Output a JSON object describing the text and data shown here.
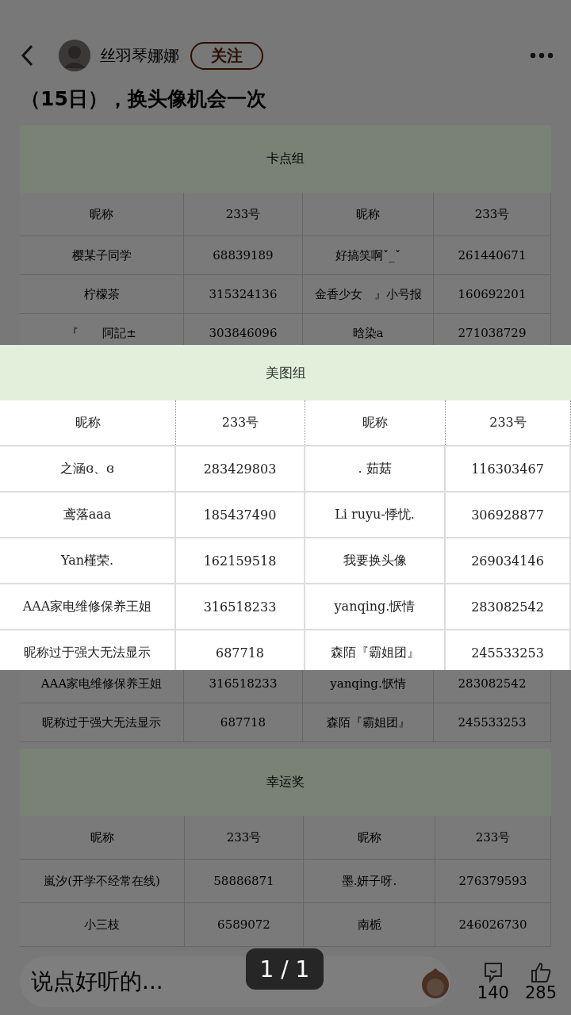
{
  "header": {
    "author": "丝羽琴娜娜",
    "follow_button": "关注"
  },
  "post_title": "（15日），换头像机会一次",
  "tables": [
    {
      "title": "卡点组",
      "columns": [
        "昵称",
        "233号",
        "昵称",
        "233号"
      ],
      "rows": [
        [
          "樱某子同学",
          "68839189",
          "好搞笑啊ˇ_ˇ",
          "261440671"
        ],
        [
          "柠檬茶",
          "315324136",
          "金香少女　』小号报",
          "160692201"
        ],
        [
          "『　　阿記±",
          "303846096",
          "晗染a",
          "271038729"
        ]
      ],
      "lower_rows": [
        [
          "AAA家电维修保养王姐",
          "316518233",
          "yanqing.恹情",
          "283082542"
        ],
        [
          "昵称过于强大无法显示",
          "687718",
          "森陌『霸姐团』",
          "245533253"
        ]
      ]
    },
    {
      "title": "幸运奖",
      "columns": [
        "昵称",
        "233号",
        "昵称",
        "233号"
      ],
      "rows": [
        [
          "嵐汐(开学不经常在线)",
          "58886871",
          "墨.妍子呀.",
          "276379593"
        ],
        [
          "小三枝",
          "6589072",
          "南栀",
          "246026730"
        ]
      ]
    }
  ],
  "viewer": {
    "title": "美图组",
    "columns": [
      "昵称",
      "233号",
      "昵称",
      "233号"
    ],
    "rows": [
      [
        "之涵ɞ、ɞ",
        "283429803",
        ". 茹菇",
        "116303467"
      ],
      [
        "鸢落aaa",
        "185437490",
        "Li ruyu-悸忧.",
        "306928877"
      ],
      [
        "Yan槿荣.",
        "162159518",
        "我要换头像",
        "269034146"
      ],
      [
        "AAA家电维修保养王姐",
        "316518233",
        "yanqing.恹情",
        "283082542"
      ],
      [
        "昵称过于强大无法显示",
        "687718",
        "森陌『霸姐团』",
        "245533253"
      ]
    ],
    "page_indicator": "1 / 1"
  },
  "bottom_bar": {
    "comment_placeholder": "说点好听的...",
    "comment_count": "140",
    "like_count": "285"
  }
}
